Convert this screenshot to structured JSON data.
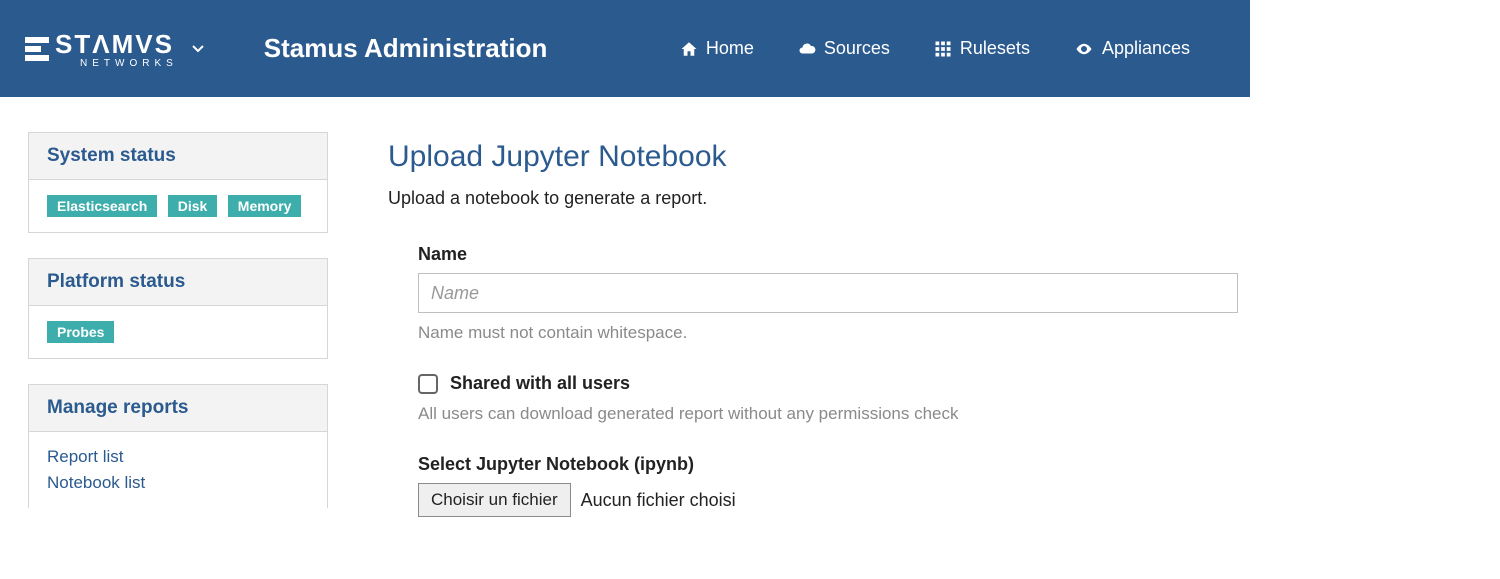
{
  "brand": {
    "name": "STΛMVS",
    "sub": "NETWORKS"
  },
  "app_title": "Stamus Administration",
  "nav": {
    "home": "Home",
    "sources": "Sources",
    "rulesets": "Rulesets",
    "appliances": "Appliances"
  },
  "sidebar": {
    "system_status": {
      "title": "System status",
      "badges": [
        "Elasticsearch",
        "Disk",
        "Memory"
      ]
    },
    "platform_status": {
      "title": "Platform status",
      "badges": [
        "Probes"
      ]
    },
    "manage_reports": {
      "title": "Manage reports",
      "links": [
        "Report list",
        "Notebook list"
      ]
    }
  },
  "main": {
    "title": "Upload Jupyter Notebook",
    "subtitle": "Upload a notebook to generate a report.",
    "name_label": "Name",
    "name_placeholder": "Name",
    "name_help": "Name must not contain whitespace.",
    "shared_label": "Shared with all users",
    "shared_help": "All users can download generated report without any permissions check",
    "file_label": "Select Jupyter Notebook (ipynb)",
    "file_button": "Choisir un fichier",
    "file_status": "Aucun fichier choisi"
  }
}
